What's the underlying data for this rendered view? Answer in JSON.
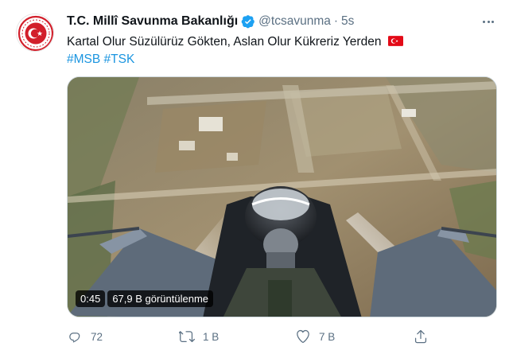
{
  "tweet": {
    "author_name": "T.C. Millî Savunma Bakanlığı",
    "handle": "@tcsavunma",
    "separator": "·",
    "time": "5s",
    "text": "Kartal Olur Süzülürüz Gökten, Aslan Olur Kükreriz Yerden",
    "hashtags": [
      "#MSB",
      "#TSK"
    ]
  },
  "video": {
    "duration": "0:45",
    "views": "67,9 B görüntülenme"
  },
  "actions": {
    "reply_count": "72",
    "retweet_count": "1 B",
    "like_count": "7 B",
    "share_count": ""
  },
  "colors": {
    "verified": "#1da1f2",
    "hashtag": "#1b95e0",
    "secondary_text": "#5b7083",
    "logo_red": "#d21f2b",
    "flag_red": "#e30a17"
  },
  "icons": {
    "verified": "verified-badge-icon",
    "more": "more-horizontal-icon",
    "reply": "reply-icon",
    "retweet": "retweet-icon",
    "like": "heart-icon",
    "share": "share-icon",
    "flag": "turkey-flag-emoji"
  }
}
